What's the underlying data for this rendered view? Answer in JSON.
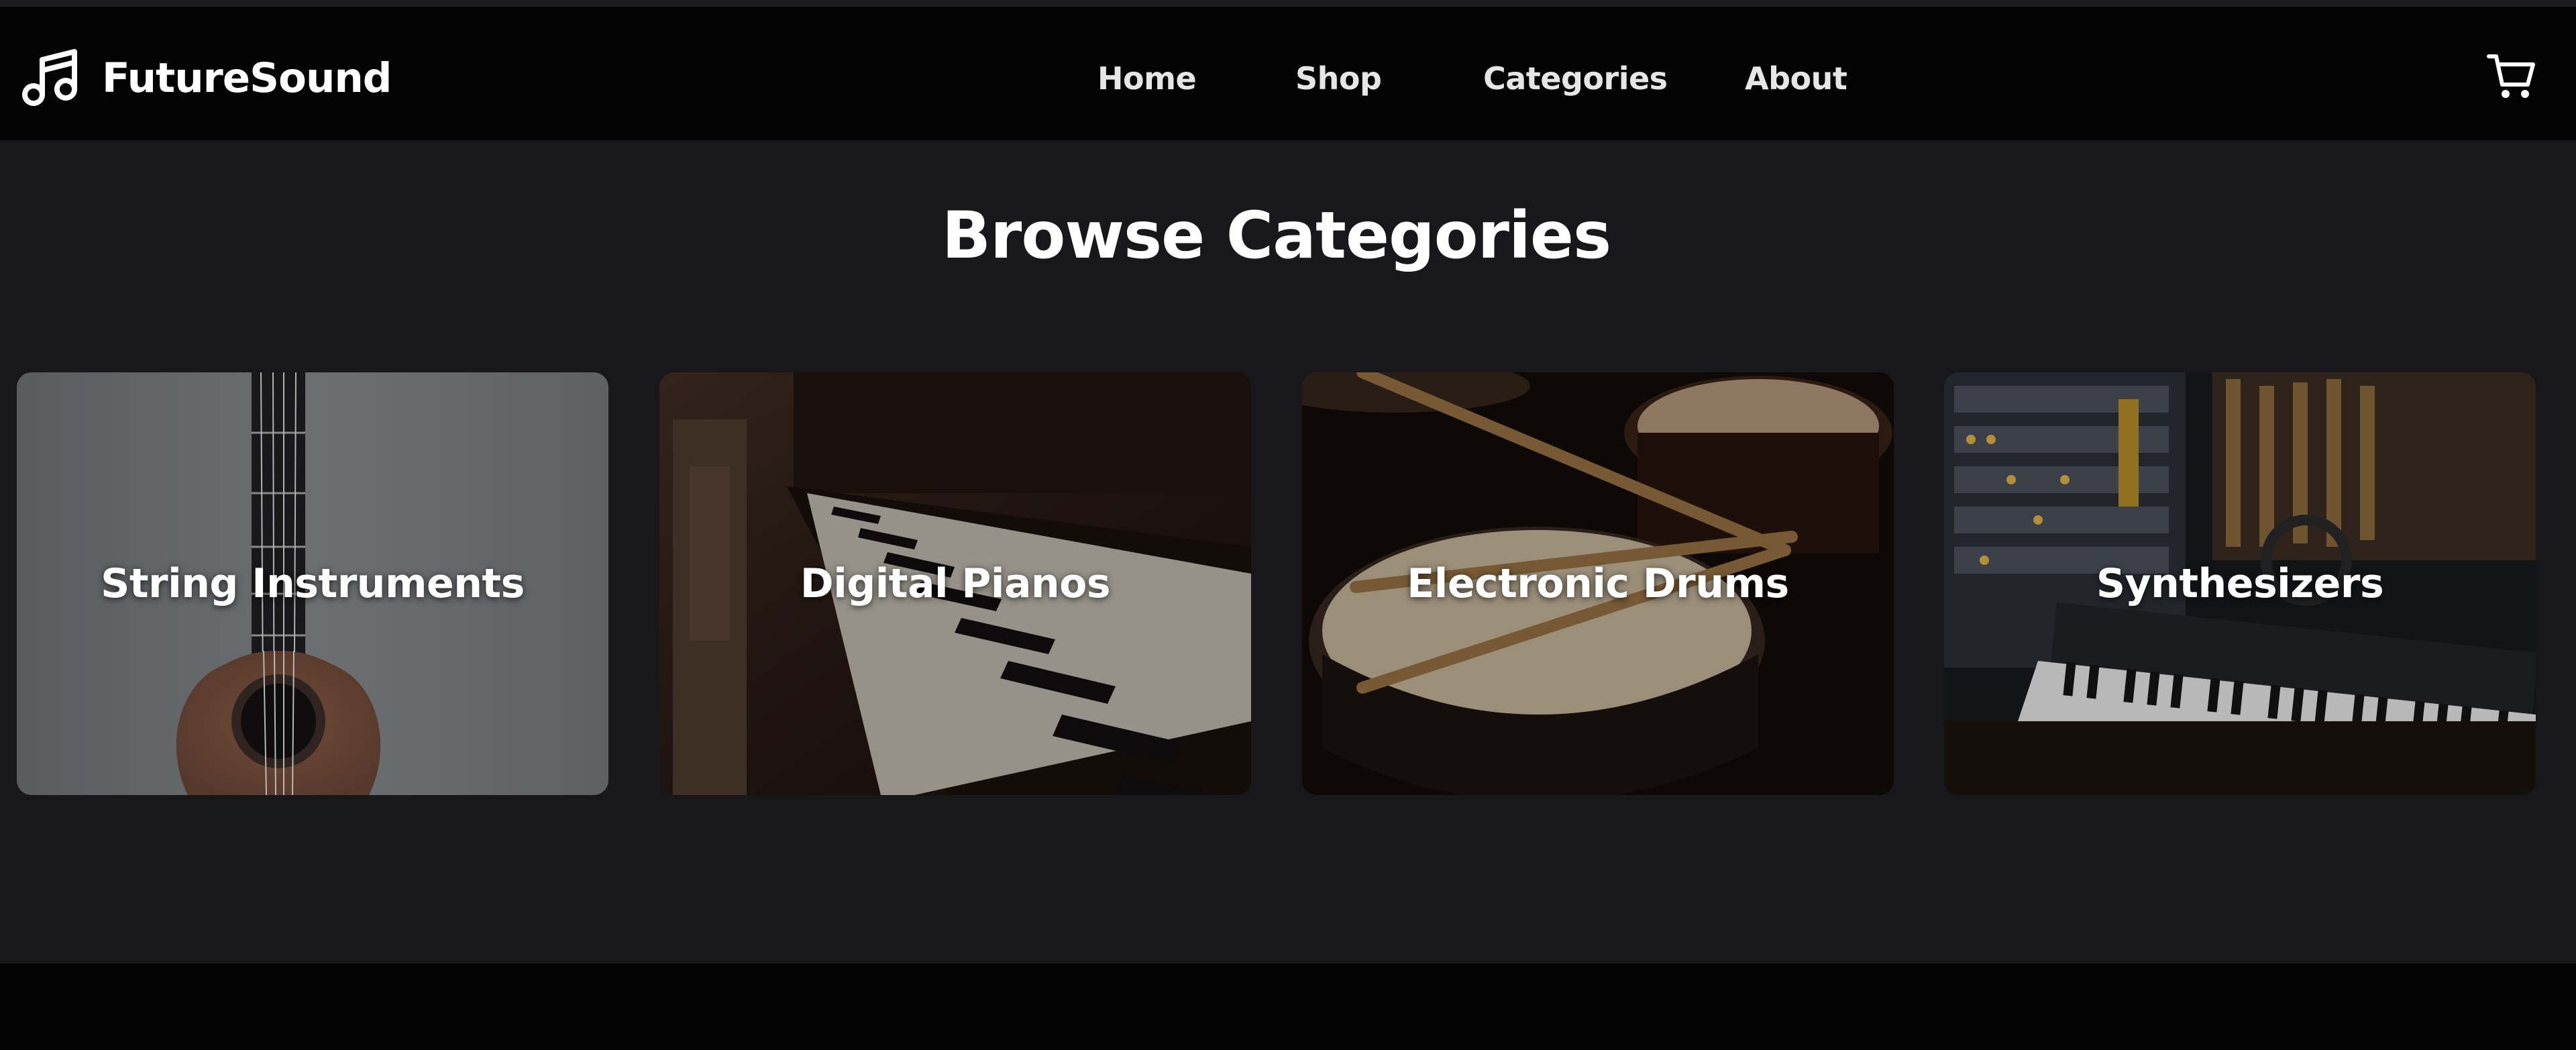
{
  "brand": {
    "name": "FutureSound",
    "icon": "music-note-icon"
  },
  "nav": {
    "items": [
      {
        "label": "Home"
      },
      {
        "label": "Shop"
      },
      {
        "label": "Categories"
      },
      {
        "label": "About"
      }
    ],
    "cart_icon": "shopping-cart-icon"
  },
  "main": {
    "title": "Browse Categories",
    "categories": [
      {
        "label": "String Instruments",
        "image": "ukulele-photo"
      },
      {
        "label": "Digital Pianos",
        "image": "piano-keys-photo"
      },
      {
        "label": "Electronic Drums",
        "image": "drum-kit-photo"
      },
      {
        "label": "Synthesizers",
        "image": "studio-synth-photo"
      }
    ]
  },
  "colors": {
    "navbar": "#030303",
    "background": "#18171a",
    "text": "#ffffff"
  }
}
